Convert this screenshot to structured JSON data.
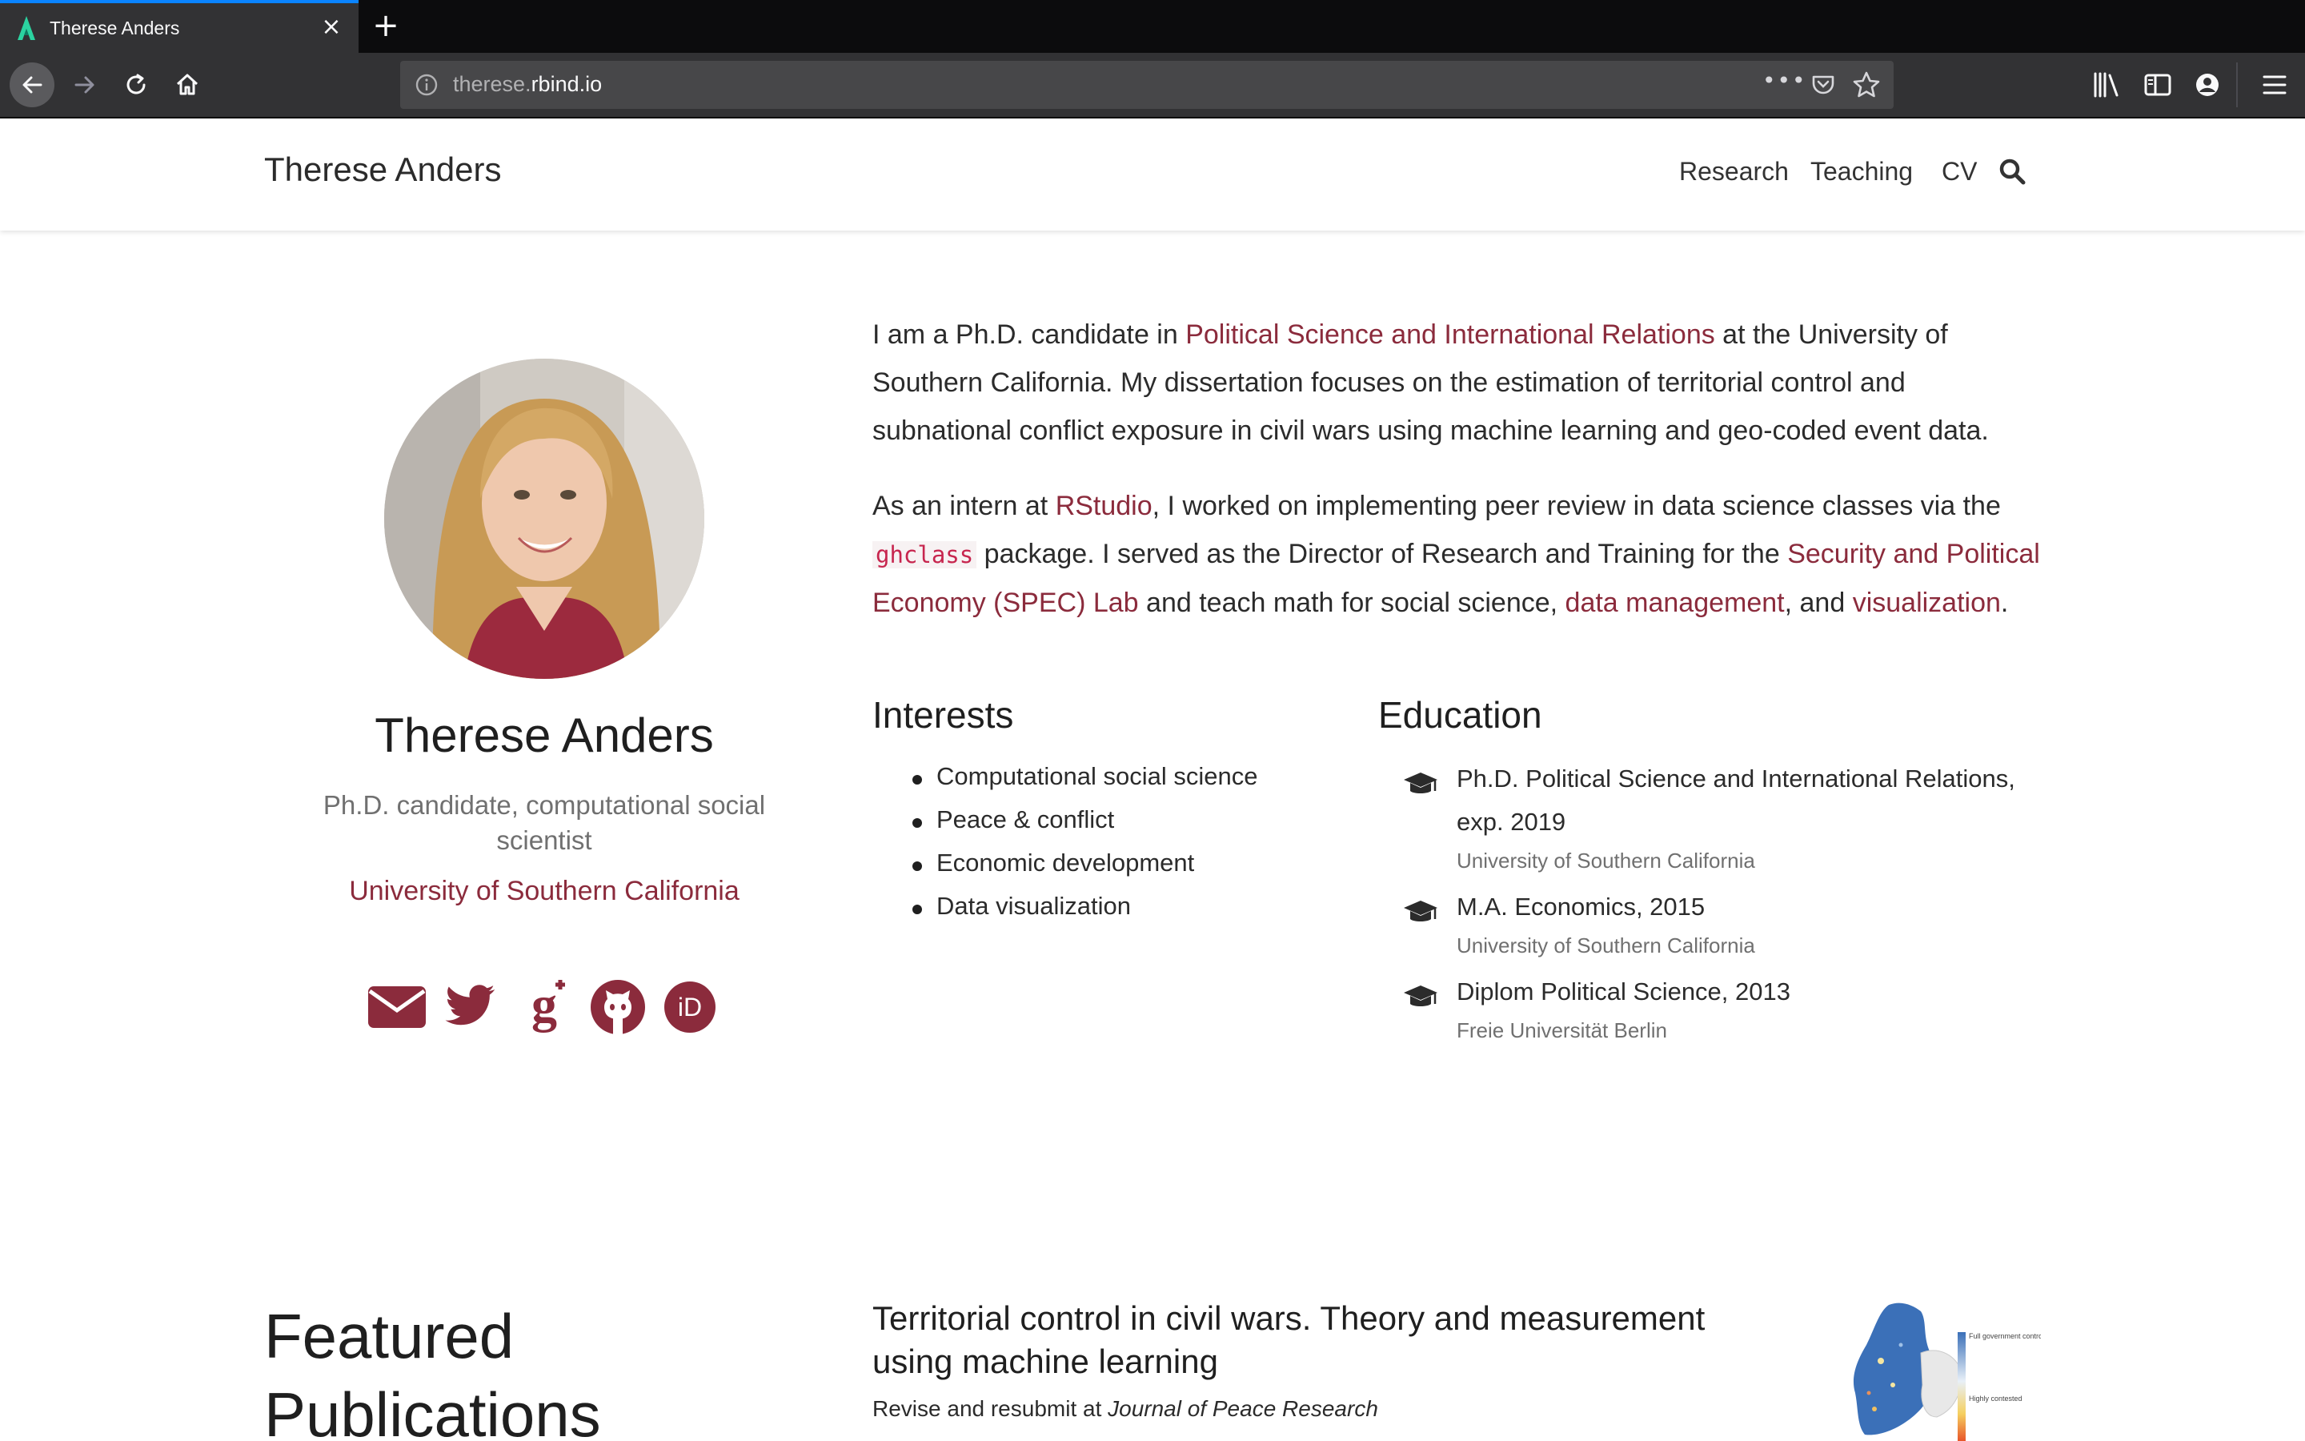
{
  "browser": {
    "tab_title": "Therese Anders",
    "tab_close": "×",
    "new_tab": "+",
    "url_prefix": "therese.",
    "url_domain": "rbind.io",
    "url_more": "•••"
  },
  "site": {
    "title": "Therese Anders",
    "nav": [
      "Research",
      "Teaching",
      "CV"
    ]
  },
  "profile": {
    "name": "Therese Anders",
    "role": "Ph.D. candidate, computational social scientist",
    "organization": "University of Southern California",
    "social_icons": [
      "envelope-icon",
      "twitter-icon",
      "google-scholar-icon",
      "github-icon",
      "orcid-icon"
    ]
  },
  "bio": {
    "p1_a": "I am a Ph.D. candidate in ",
    "p1_link": "Political Science and International Relations",
    "p1_b": " at the University of Southern California. My dissertation focuses on the estimation of territorial control and subnational conflict exposure in civil wars using machine learning and geo-coded event data.",
    "p2_a": "As an intern at ",
    "p2_link1": "RStudio",
    "p2_b": ", I worked on implementing peer review in data science classes via the ",
    "p2_code": "ghclass",
    "p2_c": " package. I served as the Director of Research and Training for the ",
    "p2_link2": "Security and Political Economy (SPEC) Lab",
    "p2_d": " and teach math for social science, ",
    "p2_link3": "data management",
    "p2_e": ", and ",
    "p2_link4": "visualization",
    "p2_f": "."
  },
  "interests": {
    "heading": "Interests",
    "items": [
      "Computational social science",
      "Peace & conflict",
      "Economic development",
      "Data visualization"
    ]
  },
  "education": {
    "heading": "Education",
    "items": [
      {
        "degree": "Ph.D. Political Science and International Relations, exp. 2019",
        "institution": "University of Southern California"
      },
      {
        "degree": "M.A. Economics, 2015",
        "institution": "University of Southern California"
      },
      {
        "degree": "Diplom Political Science, 2013",
        "institution": "Freie Universität Berlin"
      }
    ]
  },
  "featured": {
    "heading": "Featured Publications",
    "pub_title": "Territorial control in civil wars. Theory and measurement using machine learning",
    "pub_status_prefix": "Revise and resubmit at ",
    "pub_status_journal": "Journal of Peace Research",
    "map_legend_top": "Full government control",
    "map_legend_bottom": "Highly contested"
  },
  "colors": {
    "accent": "#8b2b3c",
    "chrome_dark": "#0c0c0d",
    "chrome_toolbar": "#323234",
    "tab_highlight": "#0a84ff"
  }
}
